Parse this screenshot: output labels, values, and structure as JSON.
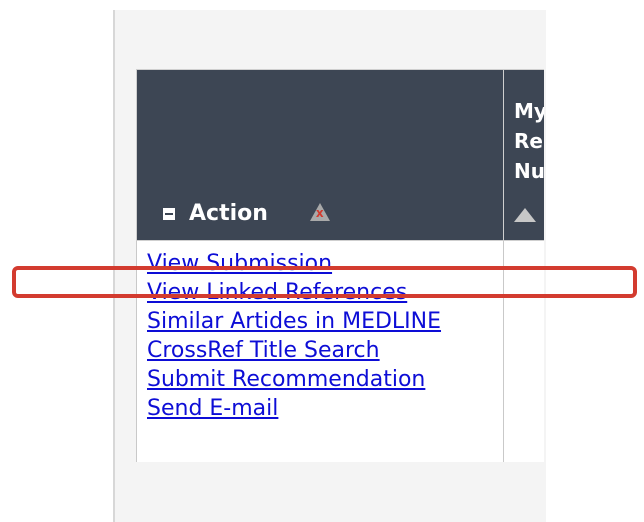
{
  "table": {
    "header_action_label": "Action",
    "header_next_label": "My\nRe\nNu",
    "links": [
      "View Submission",
      "View Linked References",
      "Similar Artides in MEDLINE",
      "CrossRef Title Search",
      "Submit Recommendation",
      "Send E-mail"
    ]
  },
  "highlight_target": "View Linked References",
  "colors": {
    "header_bg": "#3d4654",
    "link": "#0d0dd6",
    "highlight_border": "#d33b2f"
  }
}
